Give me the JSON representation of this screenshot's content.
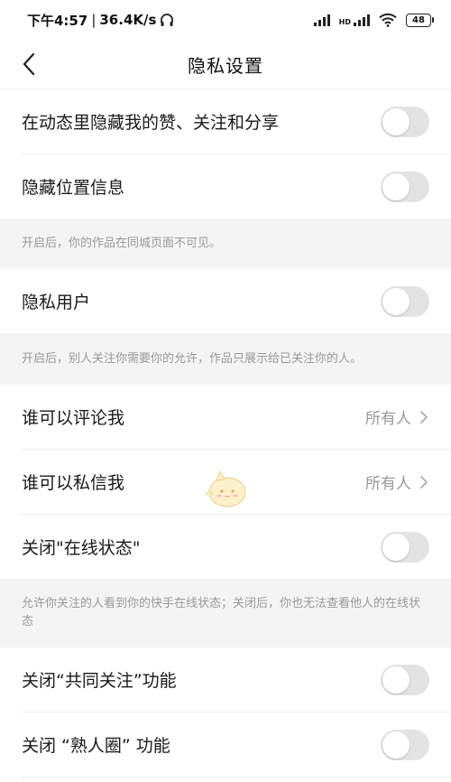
{
  "status_bar": {
    "time": "下午4:57",
    "separator": "|",
    "speed": "36.4K/s",
    "hd": "HD",
    "battery": "48"
  },
  "header": {
    "title": "隐私设置"
  },
  "settings": {
    "hide_likes": {
      "label": "在动态里隐藏我的赞、关注和分享",
      "on": false
    },
    "hide_location": {
      "label": "隐藏位置信息",
      "on": false
    },
    "hide_location_desc": "开启后，你的作品在同城页面不可见。",
    "private_user": {
      "label": "隐私用户",
      "on": false
    },
    "private_user_desc": "开启后，别人关注你需要你的允许，作品只展示给已关注你的人。",
    "who_can_comment": {
      "label": "谁可以评论我",
      "value": "所有人"
    },
    "who_can_message": {
      "label": "谁可以私信我",
      "value": "所有人"
    },
    "online_status": {
      "label": "关闭\"在线状态\"",
      "on": false
    },
    "online_status_desc": "允许你关注的人看到你的快手在线状态；关闭后，你也无法查看他人的在线状态",
    "mutual_follow": {
      "label": "关闭“共同关注”功能",
      "on": false
    },
    "acquaintance_circle": {
      "label": "关闭 “熟人圈” 功能",
      "on": false
    }
  },
  "colors": {
    "toggle_off": "#e3e3e3",
    "section_bg": "#f4f4f4",
    "secondary_text": "#999999"
  }
}
